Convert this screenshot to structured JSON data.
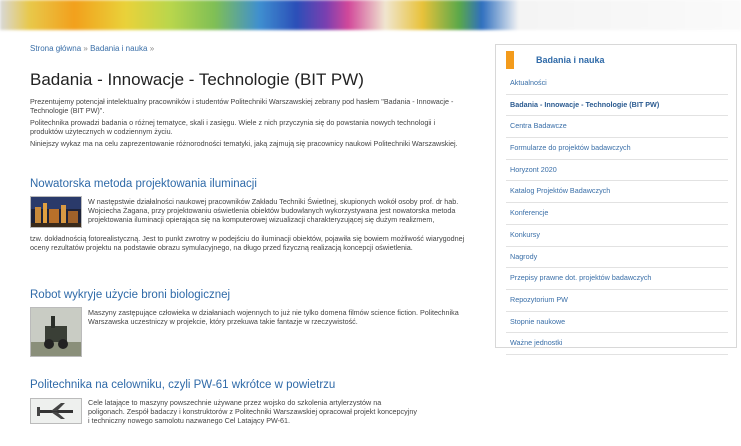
{
  "breadcrumb": {
    "home": "Strona główna",
    "section": "Badania i nauka",
    "separator": "»"
  },
  "page_title": "Badania - Innowacje - Technologie (BIT PW)",
  "intro": [
    "Prezentujemy potencjał intelektualny pracowników i studentów Politechniki Warszawskiej zebrany pod hasłem \"Badania - Innowacje - Technologie (BIT PW)\".",
    "Politechnika prowadzi badania o różnej tematyce, skali i zasięgu. Wiele z nich przyczynia się do powstania nowych technologii i produktów użytecznych w codziennym życiu.",
    "Niniejszy wykaz ma na celu zaprezentowanie różnorodności tematyki, jaką zajmują się pracownicy naukowi Politechniki Warszawskiej."
  ],
  "articles": [
    {
      "title": "Nowatorska metoda projektowania iluminacji",
      "text_beside": "W następstwie działalności naukowej pracowników Zakładu Techniki Świetlnej, skupionych wokół osoby prof. dr hab. Wojciecha Żagana, przy projektowaniu oświetlenia obiektów budowlanych wykorzystywana jest nowatorska metoda projektowania iluminacji opierająca się na komputerowej wizualizacji charakteryzującej się dużym realizmem,",
      "text_full": "tzw. dokładnością fotorealistyczną. Jest to punkt zwrotny w podejściu do iluminacji obiektów, pojawiła się bowiem możliwość wiarygodnej oceny rezultatów projektu na podstawie obrazu symulacyjnego, na długo przed fizyczną realizacją koncepcji oświetlenia."
    },
    {
      "title": "Robot wykryje użycie broni biologicznej",
      "text_beside": "Maszyny zastępujące człowieka w działaniach wojennych to już nie tylko domena filmów science fiction. Politechnika Warszawska uczestniczy w projekcie, który przekuwa takie fantazje w rzeczywistość."
    },
    {
      "title": "Politechnika na celowniku, czyli PW-61 wkrótce w powietrzu",
      "text_beside": "Cele latające to maszyny powszechnie używane przez wojsko do szkolenia artylerzystów na poligonach. Zespół badaczy i konstruktorów z Politechniki Warszawskiej opracował projekt koncepcyjny i techniczny nowego samolotu nazwanego Cel Latający PW-61."
    }
  ],
  "sidebar": {
    "heading": "Badania i nauka",
    "accent_color": "#f39b1b",
    "items": [
      "Aktualności",
      "Badania - Innowacje - Technologie (BIT PW)",
      "Centra Badawcze",
      "Formularze do projektów badawczych",
      "Horyzont 2020",
      "Katalog Projektów Badawczych",
      "Konferencje",
      "Konkursy",
      "Nagrody",
      "Przepisy prawne dot. projektów badawczych",
      "Repozytorium PW",
      "Stopnie naukowe",
      "Ważne jednostki"
    ],
    "active_index": 1
  }
}
